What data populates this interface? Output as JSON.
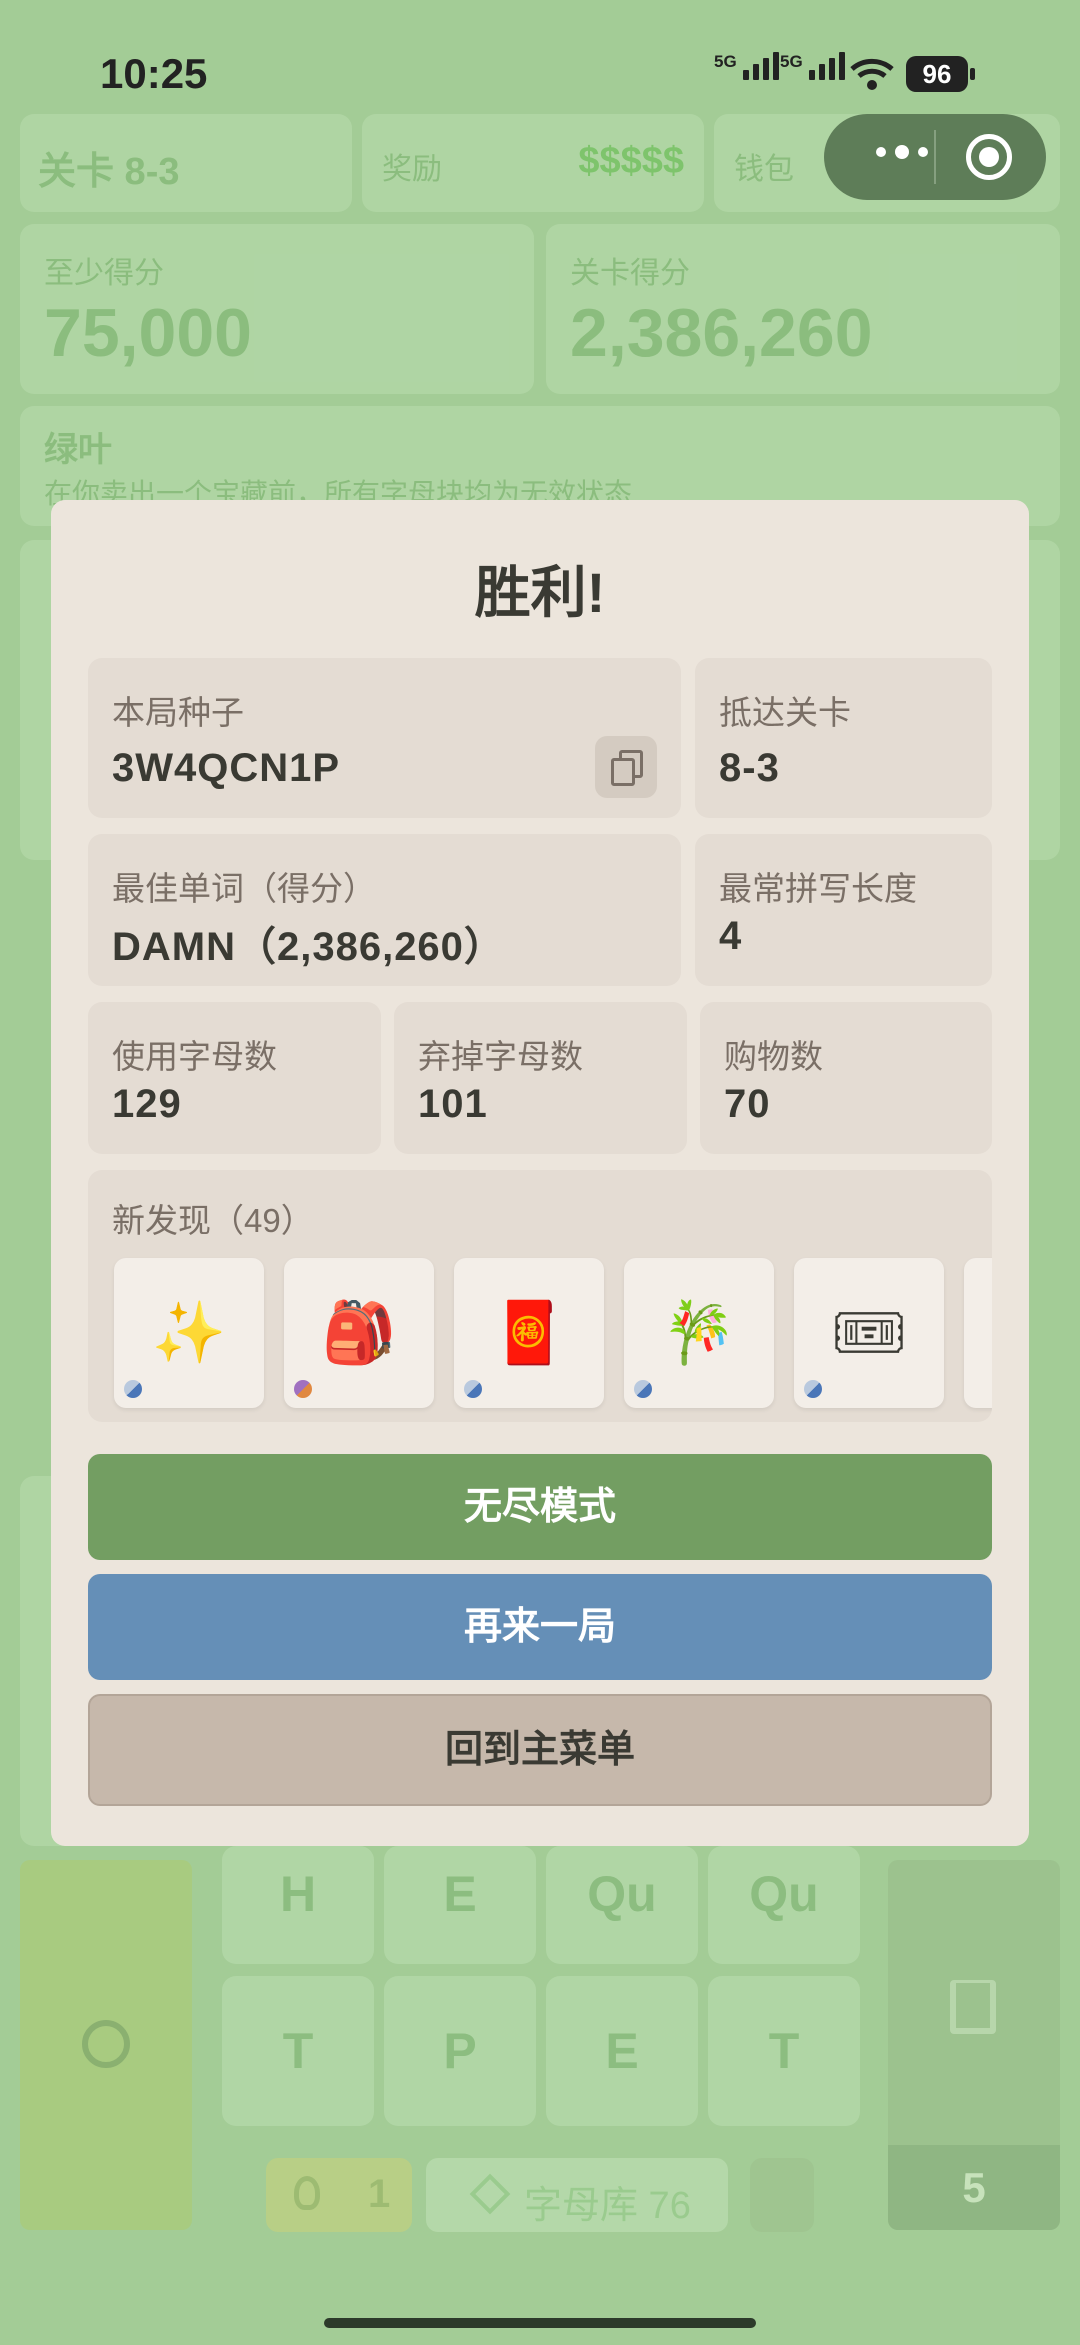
{
  "status_bar": {
    "time": "10:25",
    "net1": "5G",
    "net2": "5G",
    "battery": "96"
  },
  "background": {
    "level_label": "关卡 8-3",
    "reward_label": "奖励",
    "reward_value": "$$$$$",
    "wallet_label": "钱包",
    "min_score_label": "至少得分",
    "min_score_value": "75,000",
    "level_score_label": "关卡得分",
    "level_score_value": "2,386,260",
    "boss_name": "绿叶",
    "boss_desc": "在你卖出一个宝藏前，所有字母块均为无效状态",
    "tiles_row1": [
      "H",
      "E",
      "Qu",
      "Qu"
    ],
    "tiles_row2": [
      "T",
      "P",
      "E",
      "T"
    ],
    "hint_count": "1",
    "library_label": "字母库 76",
    "discard_count": "5"
  },
  "modal": {
    "title": "胜利!",
    "seed_label": "本局种子",
    "seed_value": "3W4QCN1P",
    "reached_label": "抵达关卡",
    "reached_value": "8-3",
    "best_word_label": "最佳单词（得分）",
    "best_word_value": "DAMN（2,386,260）",
    "common_len_label": "最常拼写长度",
    "common_len_value": "4",
    "letters_used_label": "使用字母数",
    "letters_used_value": "129",
    "letters_discarded_label": "弃掉字母数",
    "letters_discarded_value": "101",
    "purchases_label": "购物数",
    "purchases_value": "70",
    "discoveries_label": "新发现（49）",
    "discoveries": [
      "✨",
      "🎒",
      "🧧",
      "🎋",
      "🎟"
    ],
    "btn_endless": "无尽模式",
    "btn_again": "再来一局",
    "btn_menu": "回到主菜单"
  },
  "colors": {
    "endless": "#739e62",
    "again": "#658fb7",
    "menu": "#c6b8ab",
    "modal_bg": "#ece5dc"
  }
}
